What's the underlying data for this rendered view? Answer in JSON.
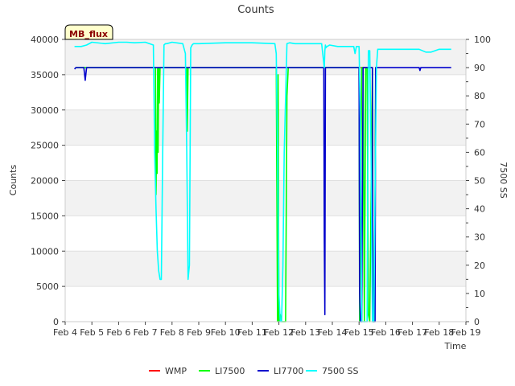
{
  "chart_data": {
    "type": "line",
    "title": "Counts",
    "xlabel": "Time",
    "ylabel": "Counts",
    "ylabel2": "7500 SS",
    "annotation": "MB_flux",
    "xlim": [
      4,
      19
    ],
    "ylim": [
      0,
      40000
    ],
    "ylim2": [
      0,
      100
    ],
    "x_ticks": [
      4,
      5,
      6,
      7,
      8,
      9,
      10,
      11,
      12,
      13,
      14,
      15,
      16,
      17,
      18,
      19
    ],
    "x_tick_labels": [
      "Feb 4",
      "Feb 5",
      "Feb 6",
      "Feb 7",
      "Feb 8",
      "Feb 9",
      "Feb 10",
      "Feb 11",
      "Feb 12",
      "Feb 13",
      "Feb 14",
      "Feb 15",
      "Feb 16",
      "Feb 17",
      "Feb 18",
      "Feb 19"
    ],
    "y_ticks": [
      0,
      5000,
      10000,
      15000,
      20000,
      25000,
      30000,
      35000,
      40000
    ],
    "y2_ticks": [
      0,
      10,
      20,
      30,
      40,
      50,
      60,
      70,
      80,
      90,
      100
    ],
    "grid": "horizontal bands",
    "legend_position": "bottom",
    "series": [
      {
        "name": "WMP",
        "color": "#ff0000",
        "axis": "left",
        "x": [
          15.05,
          15.5
        ],
        "y": [
          36000,
          36000
        ]
      },
      {
        "name": "LI7500",
        "color": "#00ff00",
        "axis": "left",
        "x": [
          4.4,
          7.38,
          7.4,
          7.42,
          7.44,
          7.46,
          7.48,
          7.5,
          7.52,
          7.55,
          8.55,
          8.57,
          8.6,
          8.62,
          11.9,
          11.95,
          11.97,
          12.0,
          12.05,
          12.1,
          12.2,
          12.25,
          12.3,
          12.35,
          15.0,
          15.02,
          15.1,
          15.15,
          15.2,
          15.25,
          15.3,
          15.35,
          15.4,
          15.5,
          15.52,
          15.55,
          15.6,
          15.62,
          15.65
        ],
        "y": [
          36000,
          36000,
          18000,
          27000,
          21000,
          36000,
          24000,
          36000,
          31000,
          36000,
          36000,
          27000,
          36000,
          36000,
          36000,
          0,
          35000,
          0,
          1000,
          0,
          0,
          0,
          32000,
          36000,
          36000,
          0,
          36000,
          36000,
          0,
          36000,
          36000,
          1000,
          0,
          36000,
          0,
          0,
          16000,
          36000,
          36000
        ]
      },
      {
        "name": "LI7700",
        "color": "#0000cc",
        "axis": "left",
        "x": [
          4.35,
          4.4,
          4.5,
          4.7,
          4.75,
          4.8,
          13.68,
          13.7,
          13.72,
          13.74,
          13.76,
          13.78,
          13.8,
          15.0,
          15.02,
          15.05,
          15.1,
          15.15,
          15.5,
          15.52,
          15.6,
          15.62,
          15.65,
          17.25,
          17.28,
          17.31,
          18.45
        ],
        "y": [
          35800,
          36000,
          36000,
          36000,
          34200,
          36000,
          36000,
          12000,
          1000,
          36000,
          36000,
          36000,
          36000,
          36000,
          4000,
          0,
          0,
          36000,
          36000,
          0,
          0,
          36000,
          36000,
          36000,
          35600,
          36000,
          36000
        ]
      },
      {
        "name": "7500 SS",
        "color": "#00ffff",
        "axis": "right",
        "x": [
          4.35,
          4.6,
          4.8,
          5.0,
          5.5,
          6.0,
          6.3,
          6.6,
          7.0,
          7.3,
          7.35,
          7.4,
          7.45,
          7.5,
          7.55,
          7.6,
          7.65,
          7.7,
          7.75,
          7.8,
          8.0,
          8.4,
          8.5,
          8.55,
          8.6,
          8.65,
          8.7,
          8.75,
          8.8,
          9.0,
          10.0,
          11.0,
          11.85,
          11.9,
          11.95,
          12.0,
          12.05,
          12.1,
          12.15,
          12.2,
          12.3,
          12.4,
          12.6,
          13.0,
          13.6,
          13.7,
          13.72,
          13.74,
          13.76,
          13.8,
          13.9,
          14.2,
          14.8,
          14.85,
          14.9,
          15.0,
          15.05,
          15.1,
          15.3,
          15.35,
          15.4,
          15.45,
          15.5,
          15.55,
          15.6,
          15.65,
          15.7,
          15.9,
          16.5,
          17.0,
          17.25,
          17.5,
          17.7,
          18.0,
          18.45
        ],
        "y": [
          97.5,
          97.5,
          98,
          99,
          98.5,
          99,
          99,
          98.8,
          99,
          98,
          60,
          40,
          25,
          18,
          15,
          15,
          60,
          98,
          98.5,
          98.5,
          99,
          98.5,
          95,
          60,
          15,
          20,
          97,
          98,
          98.5,
          98.5,
          98.8,
          98.8,
          98.5,
          95,
          60,
          10,
          0,
          0,
          20,
          60,
          98.5,
          98.8,
          98.5,
          98.5,
          98.5,
          90,
          96,
          98,
          97,
          97.5,
          98,
          97.5,
          97.5,
          95,
          97.5,
          97.5,
          70,
          0,
          0,
          96,
          96,
          60,
          0,
          0,
          45,
          90,
          96.5,
          96.5,
          96.5,
          96.5,
          96.5,
          95.5,
          95.5,
          96.5,
          96.5
        ]
      }
    ]
  }
}
